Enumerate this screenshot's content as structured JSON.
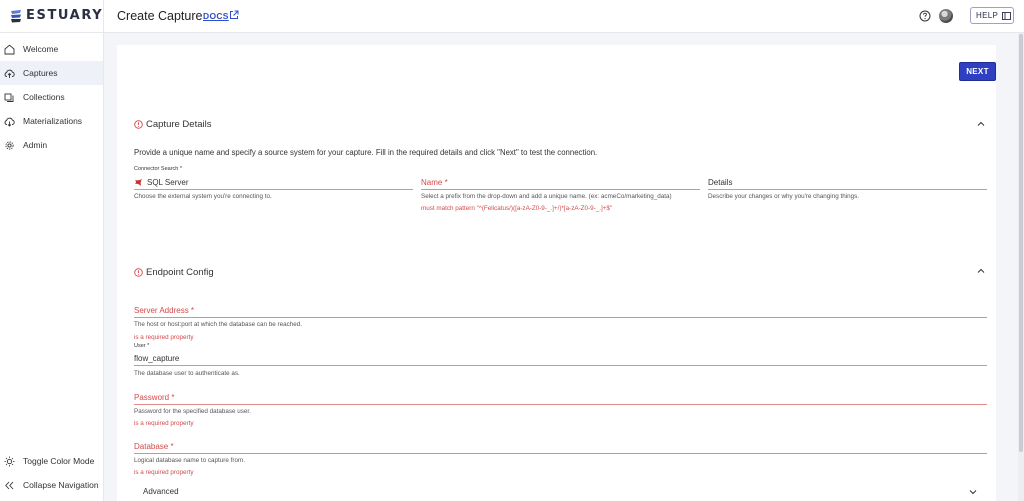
{
  "app": {
    "logo_text": "ESTUARY",
    "page_title": "Create Capture",
    "docs_label": "DOCS",
    "help_label": "HELP"
  },
  "sidebar": {
    "items": [
      {
        "label": "Welcome",
        "icon": "home-icon"
      },
      {
        "label": "Captures",
        "icon": "cloud-upload-icon"
      },
      {
        "label": "Collections",
        "icon": "collections-icon"
      },
      {
        "label": "Materializations",
        "icon": "cloud-download-icon"
      },
      {
        "label": "Admin",
        "icon": "gear-icon"
      }
    ],
    "toggle_color_mode": "Toggle Color Mode",
    "collapse_navigation": "Collapse Navigation"
  },
  "actions": {
    "next_label": "NEXT"
  },
  "capture_details": {
    "title": "Capture Details",
    "description": "Provide a unique name and specify a source system for your capture. Fill in the required details and click \"Next\" to test the connection.",
    "connector": {
      "label": "Connector Search *",
      "value": "SQL Server",
      "help": "Choose the external system you're connecting to."
    },
    "name": {
      "label": "Name *",
      "help": "Select a prefix from the drop-down and add a unique name. (ex: acmeCo/marketing_data)",
      "error": "must match pattern \"^(Felicatus/)([a-zA-Z0-9-_.]+/)*[a-zA-Z0-9-_.]+$\""
    },
    "details": {
      "label": "Details",
      "help": "Describe your changes or why you're changing things."
    }
  },
  "endpoint_config": {
    "title": "Endpoint Config",
    "server_address": {
      "label": "Server Address *",
      "help": "The host or host:port at which the database can be reached.",
      "error": "is a required property"
    },
    "user": {
      "label": "User *",
      "value": "flow_capture",
      "help": "The database user to authenticate as."
    },
    "password": {
      "label": "Password *",
      "help": "Password for the specified database user.",
      "error": "is a required property"
    },
    "database": {
      "label": "Database *",
      "help": "Logical database name to capture from.",
      "error": "is a required property"
    },
    "advanced_label": "Advanced"
  },
  "colors": {
    "accent": "#2e3fc2",
    "error": "#d34a4a",
    "brand_dark": "#2a2f45"
  }
}
